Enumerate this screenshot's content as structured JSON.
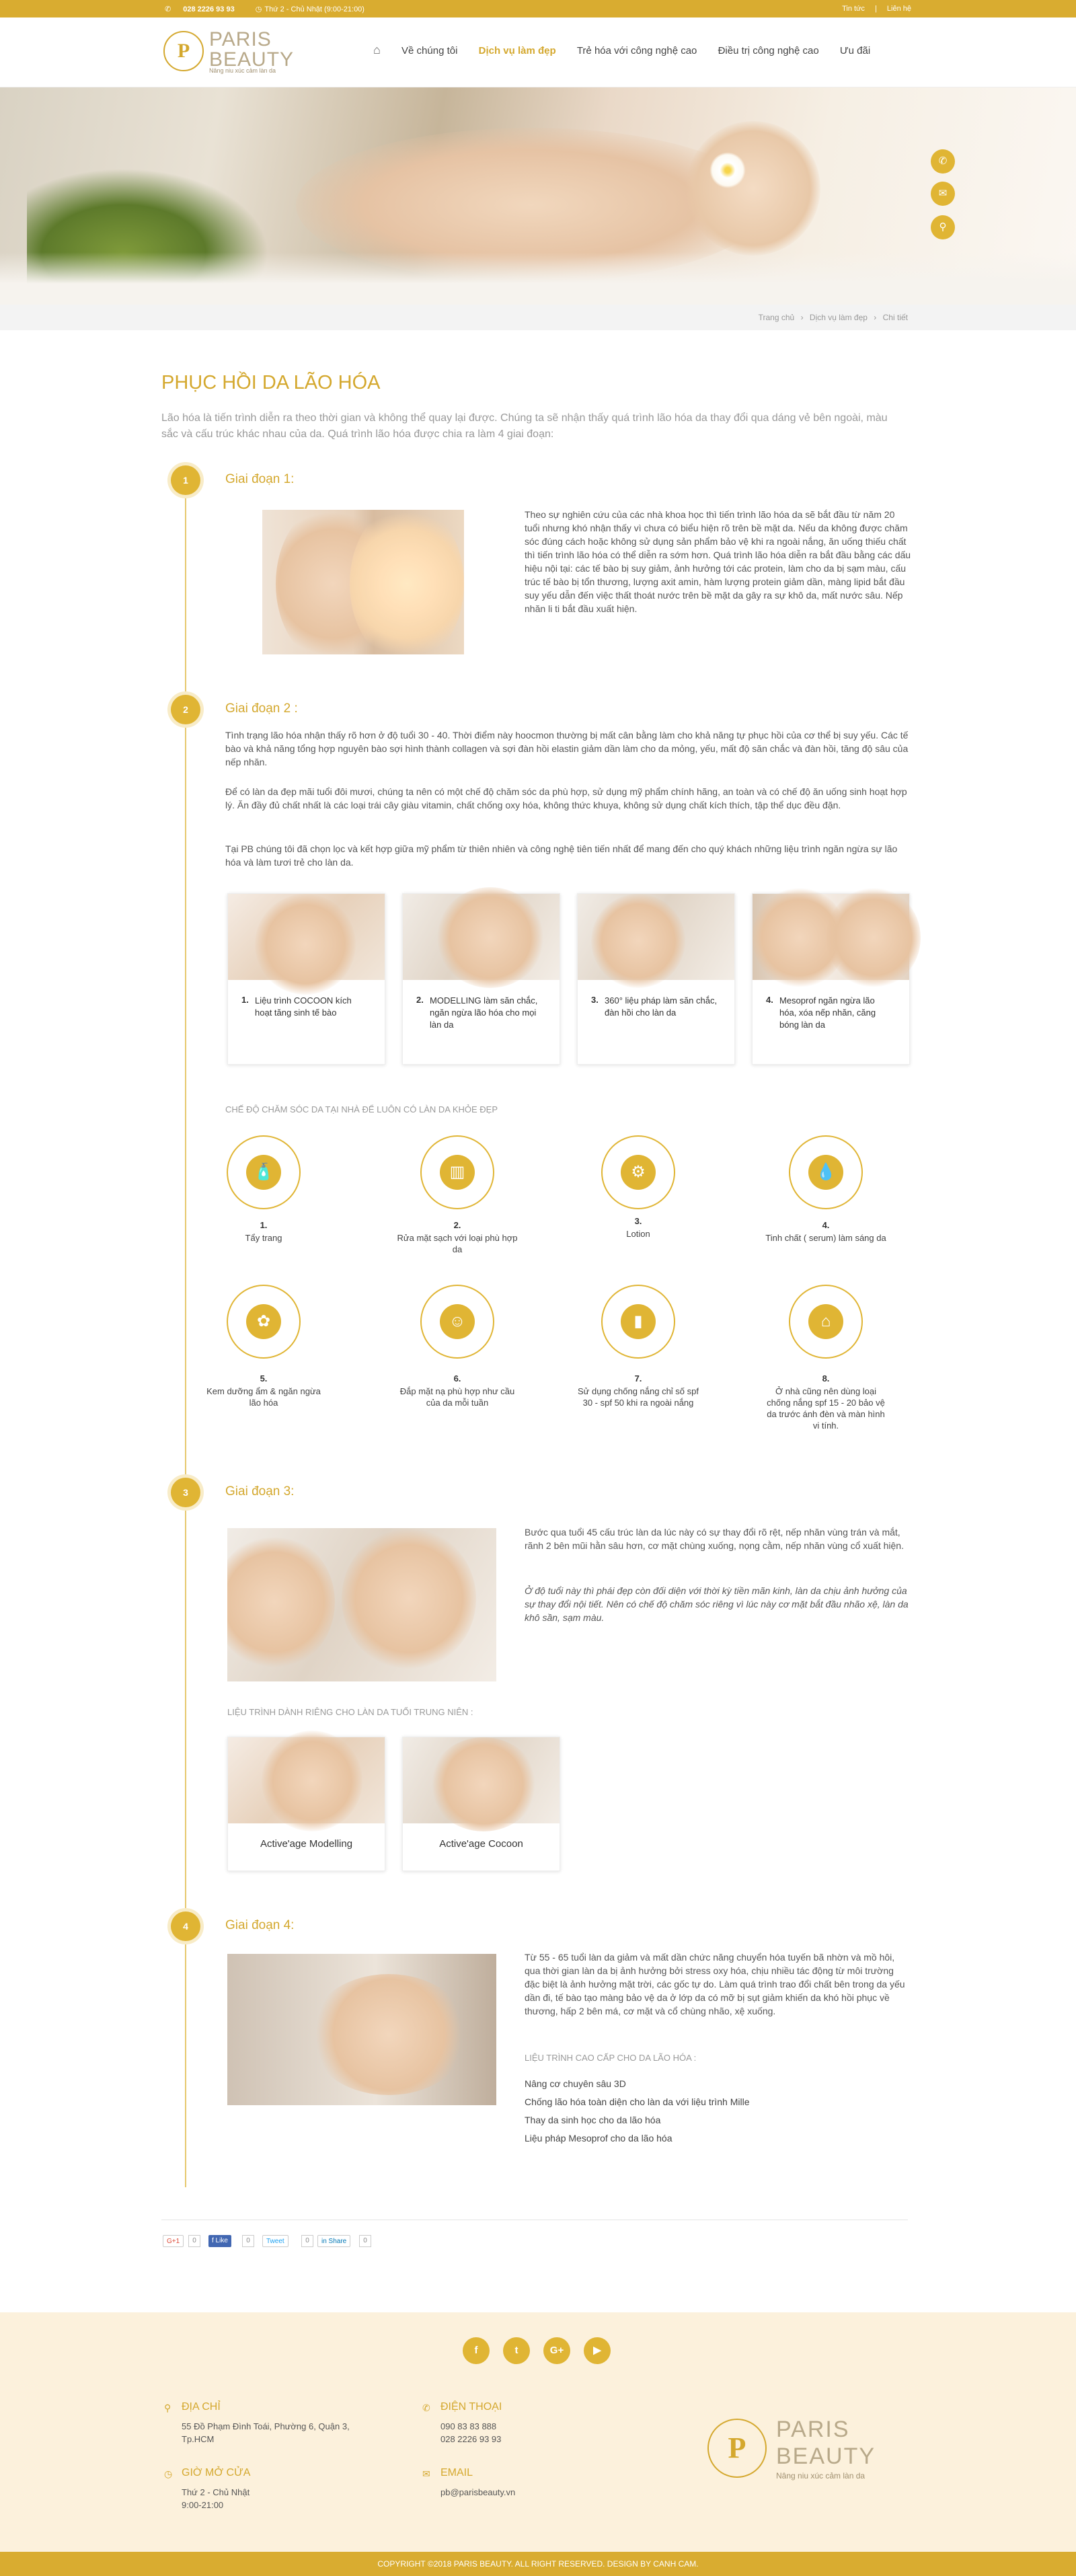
{
  "topbar": {
    "phone": "028 2226 93 93",
    "hours": "Thứ 2 - Chủ Nhật (9:00-21:00)",
    "news": "Tin tức",
    "contact": "Liên hệ"
  },
  "logo": {
    "line1": "PARIS",
    "line2": "BEAUTY",
    "tagline": "Nâng niu xúc cảm làn da",
    "mark": "P"
  },
  "nav": {
    "items": [
      "Về chúng tôi",
      "Dịch vụ làm đẹp",
      "Trẻ hóa với công nghệ cao",
      "Điều trị công nghệ cao",
      "Ưu đãi"
    ]
  },
  "breadcrumb": [
    "Trang chủ",
    "Dịch vụ làm đẹp",
    "Chi tiết"
  ],
  "page": {
    "title": "PHỤC HỒI DA LÃO HÓA",
    "intro": "Lão hóa là tiến trình diễn ra theo thời gian và không thể quay lại được. Chúng ta sẽ nhận thấy quá trình lão hóa da thay đổi qua dáng vẻ bên ngoài, màu sắc và cấu trúc khác nhau của da. Quá trình lão hóa được chia ra làm 4 giai đoạn:"
  },
  "stage1": {
    "num": "1",
    "title": "Giai đoạn 1:",
    "text": "Theo sự nghiên cứu của các nhà khoa học thì tiến trình lão hóa da sẽ bắt đầu từ năm 20 tuổi nhưng khó nhận thấy vì chưa có biểu hiện rõ trên bề mặt da. Nếu da không được chăm sóc đúng cách hoặc không sử dụng sản phẩm bảo vệ khi ra ngoài nắng, ăn uống thiếu chất thì tiến trình lão hóa có thể diễn ra sớm hơn. Quá trình lão hóa diễn ra bắt đầu bằng các dấu hiệu nội tại: các tế bào bị suy giảm, ảnh hưởng tới các protein, làm cho da bị sạm màu, cấu trúc tế bào bị tổn thương, lượng axit amin, hàm lượng protein giảm dần, màng lipid bắt đầu suy yếu dẫn đến việc thất thoát nước trên bề mặt da gây ra sự khô da, mất nước sâu. Nếp nhăn li ti bắt đầu xuất hiện."
  },
  "stage2": {
    "num": "2",
    "title": "Giai đoạn 2 :",
    "p1": "Tình trạng lão hóa nhận thấy rõ hơn ở độ tuổi 30 - 40. Thời điểm này hoocmon thường bị mất cân bằng làm cho khả năng tự phục hồi của cơ thể bị suy yếu. Các tế bào và khả năng tổng hợp nguyên bào sợi hình thành collagen và sợi đàn hồi elastin giảm dần làm cho da mỏng, yếu, mất độ săn chắc và đàn hồi, tăng độ sâu của nếp nhăn.",
    "p2": "Để có làn da đẹp mãi tuổi đôi mươi, chúng ta nên có một chế độ chăm sóc da phù hợp, sử dụng mỹ phẩm chính hãng, an toàn và có chế độ ăn uống sinh hoạt hợp lý. Ăn đầy đủ chất nhất là các loại trái cây giàu vitamin, chất chống oxy hóa, không thức khuya, không sử dụng chất kích thích, tập thể dục đều đặn.",
    "p3": "Tại PB chúng tôi đã chọn lọc và kết hợp giữa mỹ phẩm từ thiên nhiên và công nghệ tiên tiến nhất để mang đến cho quý khách những liệu trình ngăn ngừa sự lão hóa và làm tươi trẻ cho làn da.",
    "cards": [
      {
        "num": "1.",
        "text": "Liệu trình COCOON kích hoạt tăng sinh tế bào"
      },
      {
        "num": "2.",
        "text": "MODELLING làm săn chắc, ngăn ngừa lão hóa cho mọi làn da"
      },
      {
        "num": "3.",
        "text": "360° liệu pháp làm săn chắc, đàn hồi cho làn da"
      },
      {
        "num": "4.",
        "text": "Mesoprof ngăn ngừa lão hóa, xóa nếp nhăn, căng bóng làn da"
      }
    ],
    "care_heading": "CHẾ ĐỘ CHĂM SÓC DA TẠI NHÀ ĐỂ LUÔN CÓ LÀN DA KHỎE ĐẸP",
    "steps": [
      {
        "num": "1.",
        "text": "Tẩy trang",
        "icon": "cleanser-bottle-icon",
        "glyph": "🧴"
      },
      {
        "num": "2.",
        "text": "Rửa mặt sạch với loại phù hợp da",
        "icon": "towel-icon",
        "glyph": "▥"
      },
      {
        "num": "3.",
        "text": "Lotion",
        "icon": "lotion-icon",
        "glyph": "⚙"
      },
      {
        "num": "4.",
        "text": "Tinh chất ( serum) làm sáng da",
        "icon": "serum-dropper-icon",
        "glyph": "💧"
      },
      {
        "num": "5.",
        "text": "Kem dưỡng ẩm & ngăn ngừa lão hóa",
        "icon": "cream-jar-icon",
        "glyph": "✿"
      },
      {
        "num": "6.",
        "text": "Đắp mặt nạ phù hợp như cầu của da mỗi tuần",
        "icon": "face-mask-icon",
        "glyph": "☺"
      },
      {
        "num": "7.",
        "text": "Sử dụng chống nắng chỉ số spf 30 - spf 50 khi ra ngoài nắng",
        "icon": "sunscreen-tube-icon",
        "glyph": "▮"
      },
      {
        "num": "8.",
        "text": "Ở nhà cũng nên dùng loại chống nắng spf 15 - 20 bảo vệ da trước ánh đèn và màn hình vi tính.",
        "icon": "home-icon",
        "glyph": "⌂"
      }
    ]
  },
  "stage3": {
    "num": "3",
    "title": "Giai đoạn 3:",
    "p1": "Bước qua tuổi 45 cấu trúc làn da lúc này có sự thay đổi rõ rệt, nếp nhăn vùng trán và mắt, rãnh 2 bên mũi hằn sâu hơn, cơ mặt chùng xuống, nọng cằm, nếp nhăn vùng cổ xuất hiện.",
    "p2": "Ở độ tuổi này thì phái đẹp còn đối diện với thời kỳ tiền mãn kinh, làn da chịu ảnh hưởng của sự thay đổi nội tiết. Nên có chế độ chăm sóc riêng vì lúc này cơ mặt bắt đầu nhão xệ, làn da khô sần, sạm màu.",
    "sub": "LIỆU TRÌNH DÀNH RIÊNG CHO LÀN DA TUỔI TRUNG NIÊN :",
    "cards": [
      "Active'age Modelling",
      "Active'age Cocoon"
    ]
  },
  "stage4": {
    "num": "4",
    "title": "Giai đoạn 4:",
    "text": "Từ 55 - 65 tuổi làn da giảm và mất dần chức năng chuyển hóa tuyến bã nhờn và mồ hôi, qua thời gian làn da bị ảnh hưởng bởi stress oxy hóa, chịu nhiều tác động từ môi trường đặc biệt là ảnh hưởng mặt trời, các gốc tự do. Làm quá trình trao đổi chất bên trong da yếu dần đi, tế bào tạo màng bảo vệ da ở lớp da có mỡ bị sụt giảm khiến da khó hồi phục về thương, hấp 2 bên má, cơ mặt và cổ chùng nhão, xệ xuống.",
    "sub": "LIỆU TRÌNH CAO CẤP CHO DA LÃO HÓA :",
    "list": [
      "Nâng cơ chuyên sâu 3D",
      "Chống lão hóa toàn diện cho làn da với liệu trình Mille",
      "Thay da sinh học cho da lão hóa",
      "Liệu pháp Mesoprof cho da lão hóa"
    ]
  },
  "share": {
    "gplus": "G+1",
    "like": "f Like",
    "tweet": "Tweet",
    "linkedin": "in Share",
    "zero": "0"
  },
  "footer": {
    "social": [
      "f",
      "t",
      "G+",
      "▶"
    ],
    "address_title": "ĐỊA CHỈ",
    "address": "55 Đồ Phạm Đình Toái, Phường 6, Quận 3, Tp.HCM",
    "hours_title": "GIỜ MỞ CỬA",
    "hours1": "Thứ 2 - Chủ Nhật",
    "hours2": "9:00-21:00",
    "phone_title": "ĐIỆN THOẠI",
    "phone1": "090 83 83 888",
    "phone2": "028 2226 93 93",
    "email_title": "EMAIL",
    "email": "pb@parisbeauty.vn",
    "copyright": "COPYRIGHT ©2018 PARIS BEAUTY. ALL RIGHT RESERVED. DESIGN BY CANH CAM."
  },
  "colors": {
    "accent": "#d4a82e",
    "accent_light": "#f8ecc8",
    "footer_bg": "#fcf1dc"
  }
}
